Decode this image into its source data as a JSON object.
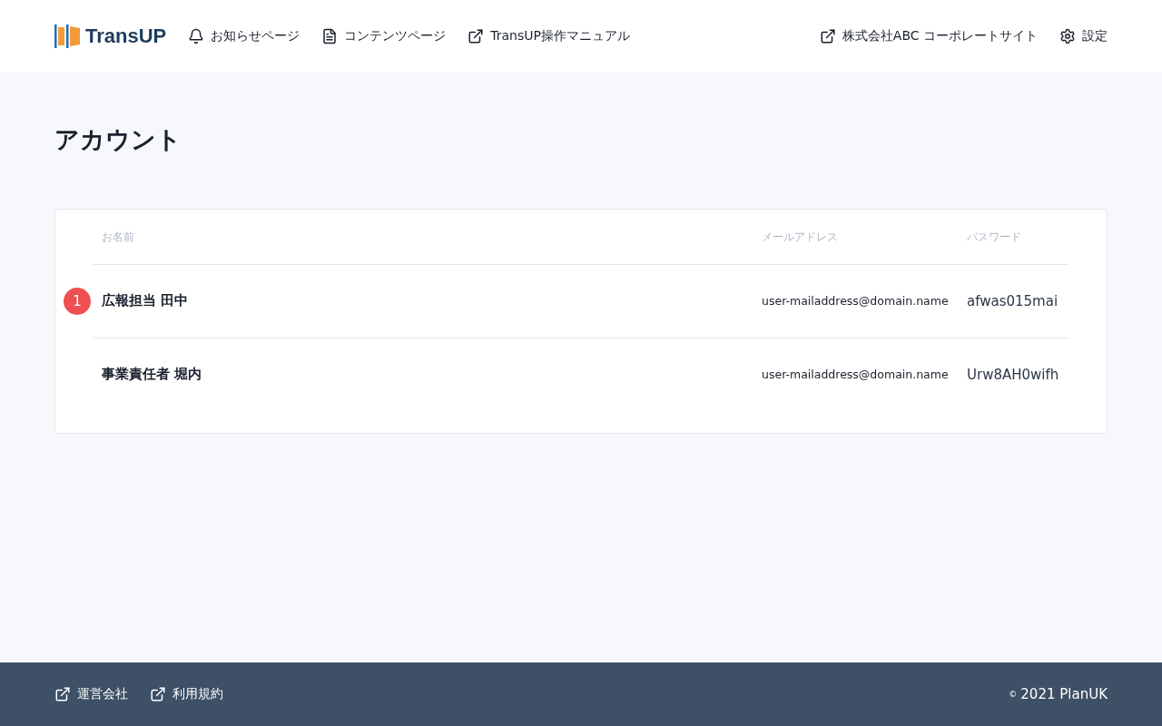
{
  "header": {
    "logo": "TransUP",
    "nav_left": [
      {
        "label": "お知らせページ",
        "kind": "notice"
      },
      {
        "label": "コンテンツページ",
        "kind": "page"
      },
      {
        "label": "TransUP操作マニュアル",
        "kind": "external"
      }
    ],
    "nav_right": [
      {
        "label": "株式会社ABC コーポレートサイト",
        "kind": "external"
      },
      {
        "label": "設定",
        "kind": "settings"
      }
    ]
  },
  "page_title": "アカウント",
  "table": {
    "columns": [
      "お名前",
      "メールアドレス",
      "パスワード"
    ],
    "rows": [
      {
        "badge": "1",
        "name": "広報担当 田中",
        "email": "user-mailaddress@domain.name",
        "password": "afwas015mai"
      },
      {
        "name": "事業責任者 堀内",
        "email": "user-mailaddress@domain.name",
        "password": "Urw8AH0wifh"
      }
    ]
  },
  "footer": {
    "links": [
      {
        "label": "運営会社",
        "kind": "external"
      },
      {
        "label": "利用規約",
        "kind": "external"
      }
    ],
    "copyright_mark": "©",
    "copyright": "2021 PlanUK"
  }
}
